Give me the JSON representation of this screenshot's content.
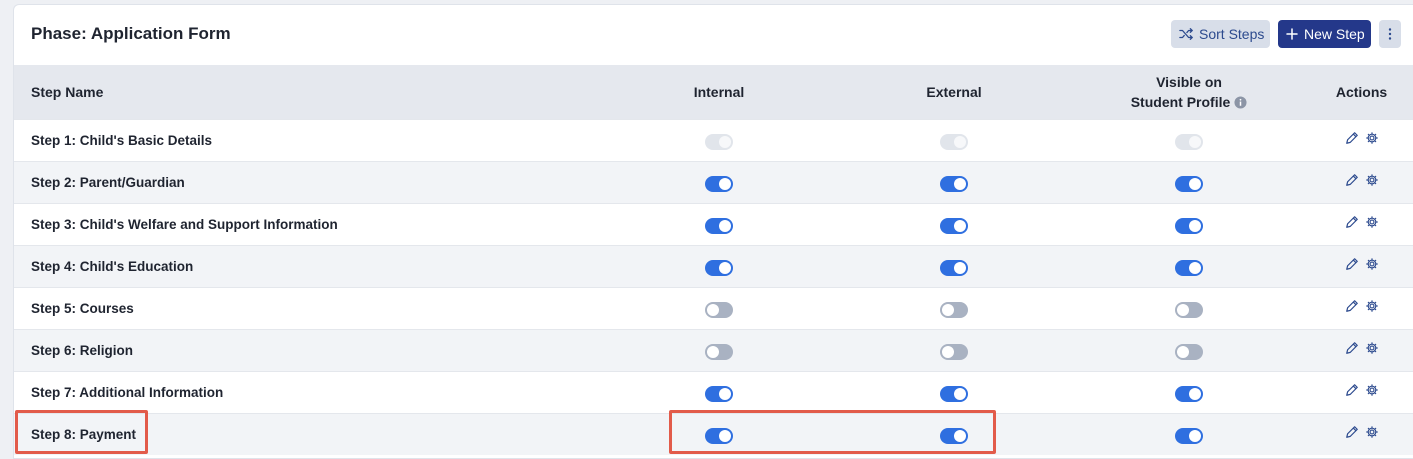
{
  "header": {
    "title": "Phase: Application Form",
    "sort_label": "Sort Steps",
    "new_label": "New Step",
    "more_icon": "more-vertical-icon"
  },
  "table": {
    "columns": {
      "name": "Step Name",
      "internal": "Internal",
      "external": "External",
      "visible_line1": "Visible on",
      "visible_line2": "Student Profile",
      "actions": "Actions"
    },
    "rows": [
      {
        "name": "Step 1: Child's Basic Details",
        "internal": "disabled",
        "external": "disabled",
        "visible": "disabled"
      },
      {
        "name": "Step 2: Parent/Guardian",
        "internal": "on",
        "external": "on",
        "visible": "on"
      },
      {
        "name": "Step 3: Child's Welfare and Support Information",
        "internal": "on",
        "external": "on",
        "visible": "on"
      },
      {
        "name": "Step 4: Child's Education",
        "internal": "on",
        "external": "on",
        "visible": "on"
      },
      {
        "name": "Step 5: Courses",
        "internal": "off",
        "external": "off",
        "visible": "off"
      },
      {
        "name": "Step 6: Religion",
        "internal": "off",
        "external": "off",
        "visible": "off"
      },
      {
        "name": "Step 7: Additional Information",
        "internal": "on",
        "external": "on",
        "visible": "on"
      },
      {
        "name": "Step 8: Payment",
        "internal": "on",
        "external": "on",
        "visible": "on"
      }
    ]
  },
  "colors": {
    "toggle_on": "#2f6fe0",
    "toggle_off": "#a9b2c2",
    "primary_button": "#24388a",
    "highlight": "#e25b4a"
  }
}
